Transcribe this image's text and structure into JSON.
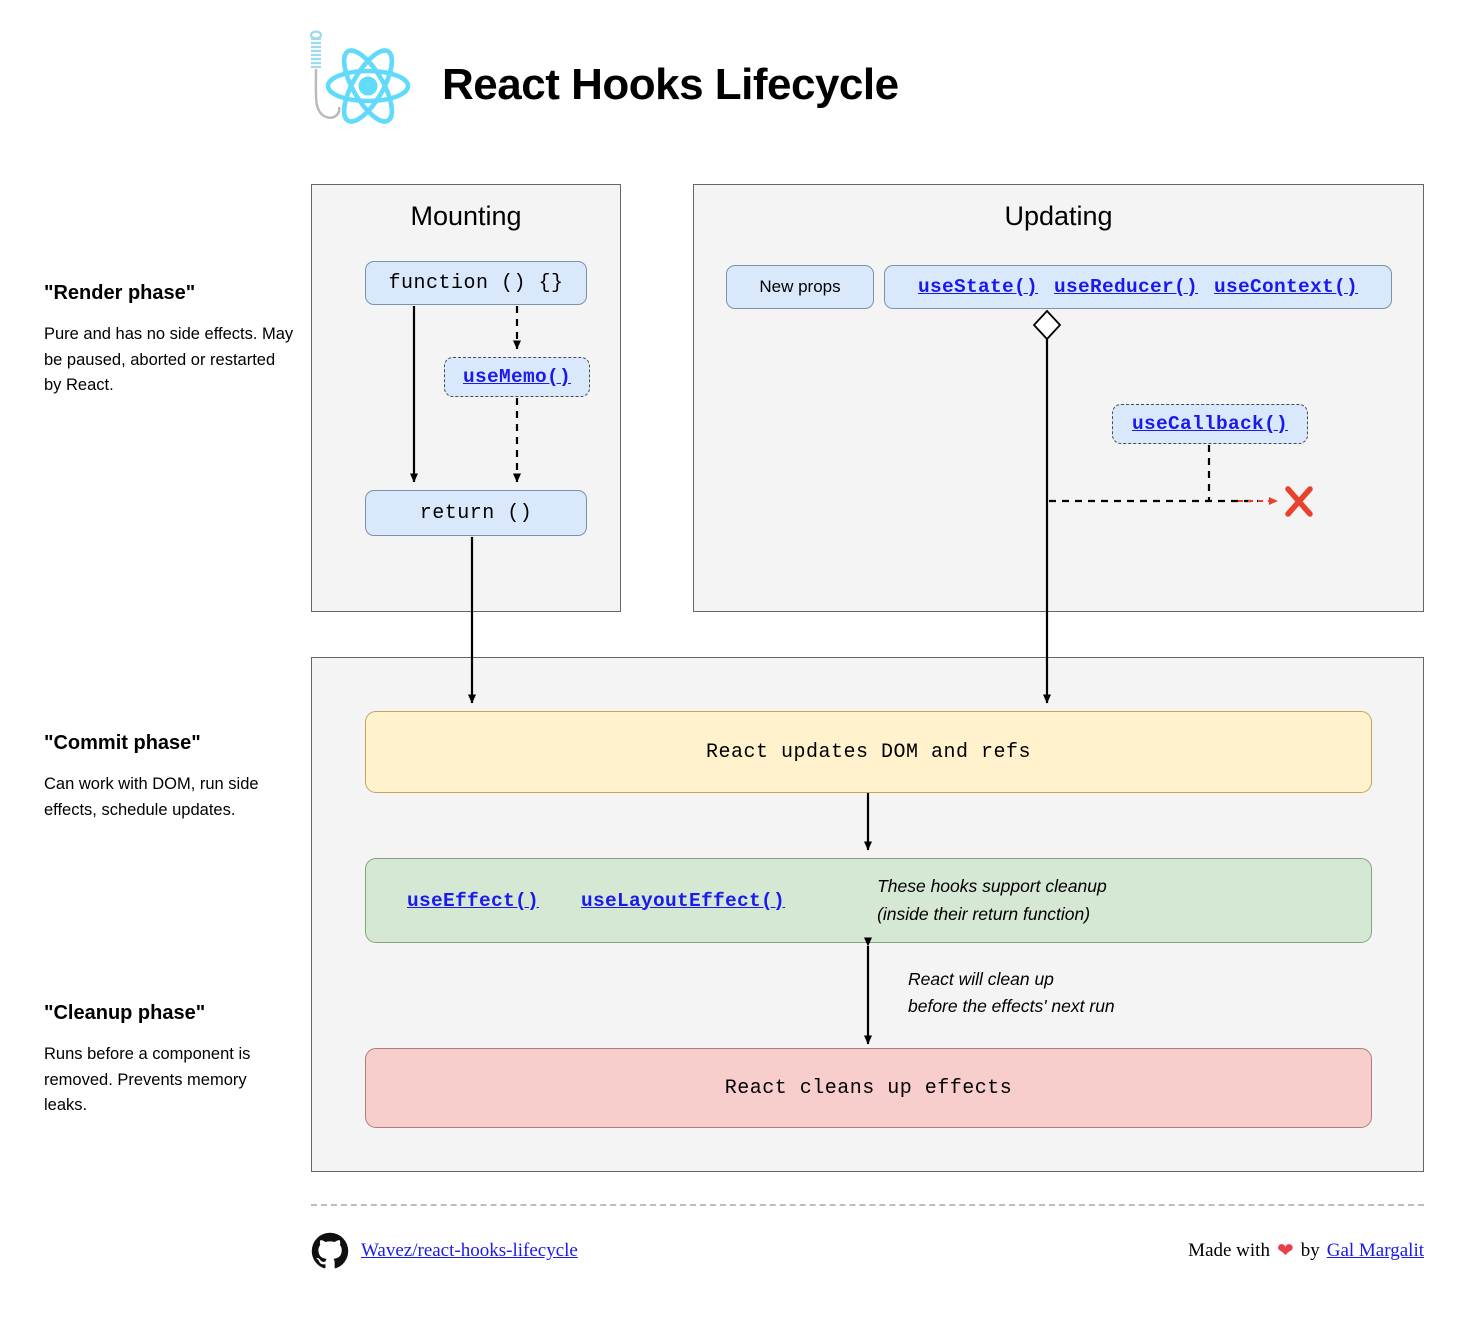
{
  "header": {
    "title": "React Hooks Lifecycle",
    "logo_icon": "react-atom-hook-logo"
  },
  "phases": [
    {
      "id": "render",
      "title": "\"Render phase\"",
      "body": "Pure and has no side effects. May be paused, aborted or restarted by React."
    },
    {
      "id": "commit",
      "title": "\"Commit phase\"",
      "body": "Can work with DOM, run side effects, schedule updates."
    },
    {
      "id": "cleanup",
      "title": "\"Cleanup phase\"",
      "body": "Runs before a component is removed. Prevents memory leaks."
    }
  ],
  "panels": {
    "mounting": {
      "title": "Mounting",
      "nodes": {
        "function": "function () {}",
        "useMemo": "useMemo()",
        "return": "return ()"
      }
    },
    "updating": {
      "title": "Updating",
      "nodes": {
        "new_props": "New props",
        "state_hooks": [
          "useState()",
          "useReducer()",
          "useContext()"
        ],
        "useCallback": "useCallback()",
        "no_rerender_marker": "X"
      }
    },
    "commit": {
      "nodes": {
        "dom_refs": "React updates DOM and refs",
        "effect_hooks": [
          "useEffect()",
          "useLayoutEffect()"
        ],
        "effects_note_line1": "These hooks support cleanup",
        "effects_note_line2": "(inside their return function)",
        "cleanup_note_line1": "React will clean up",
        "cleanup_note_line2": "before the effects' next run",
        "cleans_up": "React cleans up effects"
      }
    }
  },
  "footer": {
    "github_icon": "github-icon",
    "repo_link": "Wavez/react-hooks-lifecycle",
    "made_with": "Made with",
    "heart_icon": "heart-icon",
    "by": "by",
    "author_link": "Gal Margalit"
  },
  "colors": {
    "react_blue": "#61dafb",
    "node_blue_fill": "#dae8fc",
    "yellow_fill": "#fff2cc",
    "green_fill": "#d5e8d4",
    "red_fill": "#f8cecc",
    "link_blue": "#1a1aee",
    "x_red": "#e8422e",
    "panel_fill": "#f4f4f4"
  }
}
